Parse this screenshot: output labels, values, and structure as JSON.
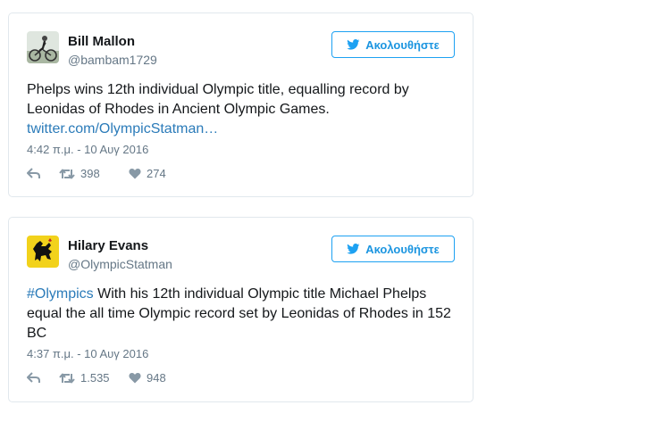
{
  "follow_label": "Ακολουθήστε",
  "colors": {
    "accent": "#1da1f2",
    "link": "#2b7bb9",
    "muted": "#657786"
  },
  "tweets": [
    {
      "name": "Bill Mallon",
      "handle": "@bambam1729",
      "text": "Phelps wins 12th individual Olympic title, equalling record by Leonidas of Rhodes in Ancient Olympic Games.",
      "link": "twitter.com/OlympicStatman…",
      "timestamp": "4:42 π.μ. - 10 Αυγ 2016",
      "retweets": "398",
      "likes": "274"
    },
    {
      "name": "Hilary Evans",
      "handle": "@OlympicStatman",
      "hashtag": "#Olympics",
      "text": " With his 12th individual Olympic title Michael Phelps equal the all time Olympic record set by Leonidas of Rhodes in 152 BC",
      "timestamp": "4:37 π.μ. - 10 Αυγ 2016",
      "retweets": "1.535",
      "likes": "948"
    }
  ]
}
